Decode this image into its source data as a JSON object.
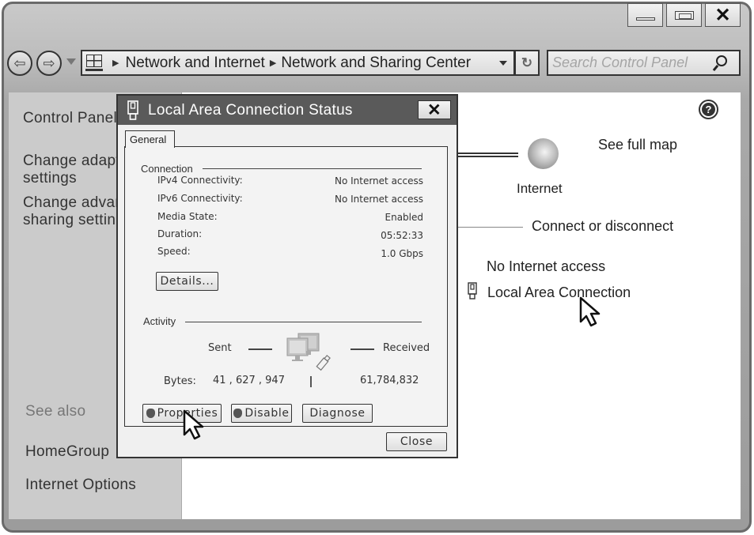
{
  "window": {
    "controls": {
      "minimize": "minimize",
      "maximize": "maximize",
      "close": "✕"
    }
  },
  "navigation": {
    "back_icon": "⇦",
    "forward_icon": "⇨",
    "breadcrumb": [
      "Network and Internet",
      "Network and Sharing Center"
    ],
    "refresh_icon": "↻",
    "search_placeholder": "Search Control Panel"
  },
  "sidebar": {
    "items": [
      {
        "label": "Control Panel"
      },
      {
        "label": "Change adapter settings"
      },
      {
        "label": "Change advanced sharing settings"
      }
    ],
    "see_also_heading": "See also",
    "see_also": [
      {
        "label": "HomeGroup"
      },
      {
        "label": "Internet Options"
      }
    ]
  },
  "main": {
    "help_icon": "?",
    "see_full_map": "See full map",
    "internet_label": "Internet",
    "connect_or_disconnect": "Connect or disconnect",
    "access_type": "No Internet access",
    "connection_link": "Local Area Connection"
  },
  "dialog": {
    "title": "Local Area Connection Status",
    "close_glyph": "✕",
    "tab": "General",
    "connection": {
      "heading": "Connection",
      "rows": [
        {
          "label": "IPv4 Connectivity:",
          "value": "No Internet access"
        },
        {
          "label": "IPv6 Connectivity:",
          "value": "No Internet access"
        },
        {
          "label": "Media State:",
          "value": "Enabled"
        },
        {
          "label": "Duration:",
          "value": "05:52:33"
        },
        {
          "label": "Speed:",
          "value": "1.0 Gbps"
        }
      ],
      "details_button": "Details..."
    },
    "activity": {
      "heading": "Activity",
      "sent_label": "Sent",
      "received_label": "Received",
      "bytes_label": "Bytes:",
      "bytes_sent": "41 , 627 , 947",
      "bytes_received": "61,784,832"
    },
    "buttons": {
      "properties": "Properties",
      "disable": "Disable",
      "diagnose": "Diagnose",
      "close": "Close"
    }
  }
}
